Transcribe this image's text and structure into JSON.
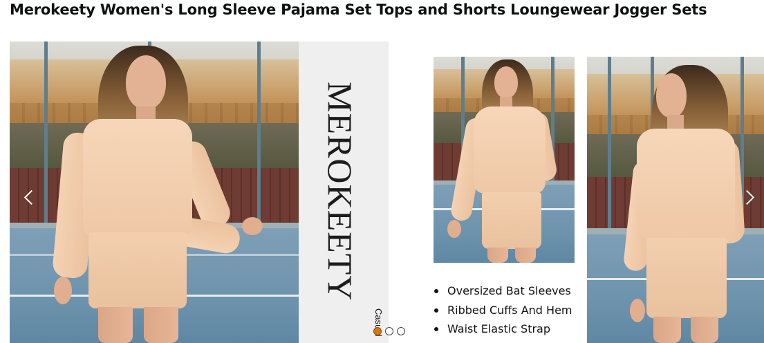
{
  "product": {
    "title": "Merokeety Women's Long Sleeve Pajama Set Tops and Shorts Loungewear Jogger Sets"
  },
  "carousel": {
    "brand_text": "MEROKEETY",
    "caption": "Casual",
    "features": [
      "Oversized Bat Sleeves",
      "Ribbed Cuffs And Hem",
      "Waist Elastic Strap"
    ],
    "pagination": {
      "total": 3,
      "active_index": 0
    },
    "prev_icon": "chevron-left-icon",
    "next_icon": "chevron-right-icon"
  },
  "colors": {
    "active_dot": "#d57a10",
    "garment": "#f3d0b0"
  }
}
